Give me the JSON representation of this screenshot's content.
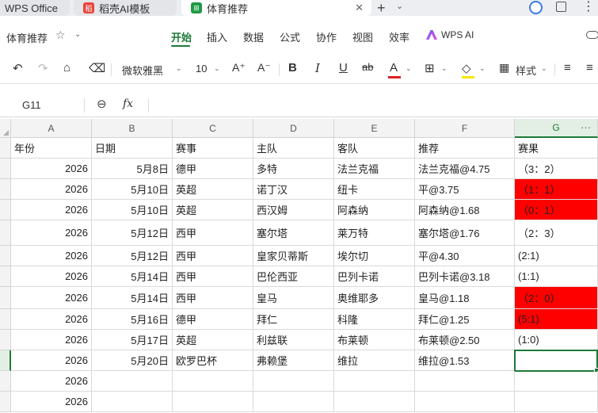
{
  "tabs": [
    {
      "label": "WPS Office"
    },
    {
      "label": "稻壳AI模板"
    },
    {
      "label": "体育推荐"
    }
  ],
  "document_title": "体育推荐",
  "menu": [
    "开始",
    "插入",
    "数据",
    "公式",
    "协作",
    "视图",
    "效率"
  ],
  "wps_ai_label": "WPS AI",
  "toolbar": {
    "font_name": "微软雅黑",
    "font_size": "10",
    "style_label": "样式"
  },
  "formula_bar": {
    "name_box": "G11",
    "fx_label": "fx",
    "formula": ""
  },
  "columns": [
    "A",
    "B",
    "C",
    "D",
    "E",
    "F",
    "G"
  ],
  "headers": [
    "年份",
    "日期",
    "赛事",
    "主队",
    "客队",
    "推荐",
    "赛果"
  ],
  "rows": [
    {
      "year": "2026",
      "date": "5月8日",
      "league": "德甲",
      "home": "多特",
      "away": "法兰克福",
      "pick": "法兰克福@4.75",
      "result": "（3：2）",
      "highlight": false
    },
    {
      "year": "2026",
      "date": "5月10日",
      "league": "英超",
      "home": "诺丁汉",
      "away": "纽卡",
      "pick": "平@3.75",
      "result": "（1：1）",
      "highlight": true
    },
    {
      "year": "2026",
      "date": "5月10日",
      "league": "英超",
      "home": "西汉姆",
      "away": "阿森纳",
      "pick": "阿森纳@1.68",
      "result": "（0：1）",
      "highlight": true
    },
    {
      "year": "2026",
      "date": "5月12日",
      "league": "西甲",
      "home": "塞尔塔",
      "away": "莱万特",
      "pick": "塞尔塔@1.76",
      "result": "（2：3）",
      "highlight": false
    },
    {
      "year": "2026",
      "date": "5月12日",
      "league": "西甲",
      "home": "皇家贝蒂斯",
      "away": "埃尔切",
      "pick": "平@4.30",
      "result": "(2:1)",
      "highlight": false
    },
    {
      "year": "2026",
      "date": "5月14日",
      "league": "西甲",
      "home": "巴伦西亚",
      "away": "巴列卡诺",
      "pick": "巴列卡诺@3.18",
      "result": "(1:1)",
      "highlight": false
    },
    {
      "year": "2026",
      "date": "5月14日",
      "league": "西甲",
      "home": "皇马",
      "away": "奥维耶多",
      "pick": "皇马@1.18",
      "result": "（2：0）",
      "highlight": true
    },
    {
      "year": "2026",
      "date": "5月16日",
      "league": "德甲",
      "home": "拜仁",
      "away": "科隆",
      "pick": "拜仁@1.25",
      "result": "(5:1)",
      "highlight": true
    },
    {
      "year": "2026",
      "date": "5月17日",
      "league": "英超",
      "home": "利兹联",
      "away": "布莱顿",
      "pick": "布莱顿@2.50",
      "result": "(1:0)",
      "highlight": false
    },
    {
      "year": "2026",
      "date": "5月20日",
      "league": "欧罗巴杯",
      "home": "弗赖堡",
      "away": "维拉",
      "pick": "维拉@1.53",
      "result": "",
      "highlight": false
    },
    {
      "year": "2026",
      "date": "",
      "league": "",
      "home": "",
      "away": "",
      "pick": "",
      "result": "",
      "highlight": false
    },
    {
      "year": "2026",
      "date": "",
      "league": "",
      "home": "",
      "away": "",
      "pick": "",
      "result": "",
      "highlight": false
    }
  ],
  "colors": {
    "accent": "#1d7a38",
    "highlight": "#ff0000"
  }
}
